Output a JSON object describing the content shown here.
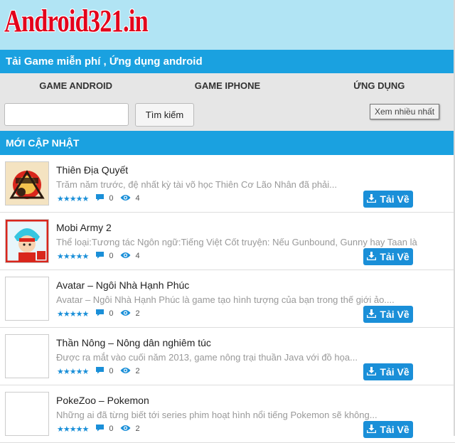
{
  "header": {
    "logo_text": "Android321.in"
  },
  "tagline": "Tải Game miễn phí , Ứng dụng android",
  "nav": {
    "items": [
      {
        "label": "GAME ANDROID"
      },
      {
        "label": "GAME IPHONE"
      },
      {
        "label": "ỨNG DỤNG"
      }
    ]
  },
  "search": {
    "value": "",
    "placeholder": "",
    "button_label": "Tìm kiếm"
  },
  "tooltip": "Xem nhiều nhất",
  "section_title": "MỚI CẬP NHẬT",
  "colors": {
    "accent": "#1aa1e0",
    "button": "#1a8fd8",
    "header_bg": "#b1e4f4",
    "logo": "#e3001b"
  },
  "items": [
    {
      "title": "Thiên Địa Quyết",
      "desc": "Trăm năm trước, đệ nhất kỳ tài võ học Thiên Cơ Lão Nhân đã phải...",
      "stars": "★★★★★",
      "comments": "0",
      "views": "4",
      "button": "Tải Về",
      "thumb": "thien-dia-quyet-art"
    },
    {
      "title": "Mobi Army 2",
      "desc": "  Thể loại:Tương tác Ngôn ngữ:Tiếng Việt Cốt truyện: Nếu Gunbound, Gunny hay Taan là",
      "stars": "★★★★★",
      "comments": "0",
      "views": "4",
      "button": "Tải Về",
      "thumb": "mobi-army-art"
    },
    {
      "title": "Avatar – Ngôi Nhà Hạnh Phúc",
      "desc": "Avatar – Ngôi Nhà Hạnh Phúc là game tạo hình tượng của bạn trong thế giới ảo....",
      "stars": "★★★★★",
      "comments": "0",
      "views": "2",
      "button": "Tải Về",
      "thumb": "blank"
    },
    {
      "title": "Thần Nông – Nông dân nghiêm túc",
      "desc": "Được ra mắt vào cuối năm 2013, game nông trại thuần Java với đồ họa...",
      "stars": "★★★★★",
      "comments": "0",
      "views": "2",
      "button": "Tải Về",
      "thumb": "blank"
    },
    {
      "title": "PokeZoo – Pokemon",
      "desc": "Những ai đã từng biết tới series phim hoạt hình nổi tiếng Pokemon sẽ không...",
      "stars": "★★★★★",
      "comments": "0",
      "views": "2",
      "button": "Tải Về",
      "thumb": "blank"
    }
  ]
}
